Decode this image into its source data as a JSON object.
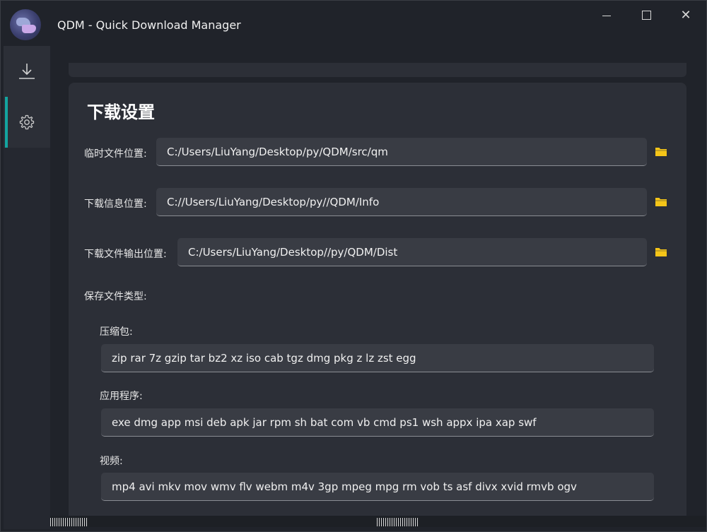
{
  "window": {
    "title": "QDM - Quick Download Manager",
    "min_symbol": "",
    "close_symbol": "✕"
  },
  "sidebar": {
    "items": [
      {
        "name": "download",
        "icon": "download-icon"
      },
      {
        "name": "settings",
        "icon": "gear-icon",
        "active": true
      }
    ]
  },
  "settings": {
    "title": "下载设置",
    "temp_location": {
      "label": "临时文件位置:",
      "value": "C:/Users/LiuYang/Desktop/py/QDM/src/qm"
    },
    "info_location": {
      "label": "下载信息位置:",
      "value": "C://Users/LiuYang/Desktop/py//QDM/Info"
    },
    "output_location": {
      "label": "下载文件输出位置:",
      "value": "C:/Users/LiuYang/Desktop//py/QDM/Dist"
    },
    "file_types_label": "保存文件类型:",
    "file_types": [
      {
        "label": "压缩包:",
        "value": "zip rar 7z gzip tar bz2 xz iso cab tgz dmg pkg z lz zst egg"
      },
      {
        "label": "应用程序:",
        "value": "exe dmg app msi deb apk jar rpm sh bat com vb cmd ps1 wsh appx ipa xap swf"
      },
      {
        "label": "视频:",
        "value": "mp4 avi mkv mov wmv flv webm m4v 3gp mpeg mpg rm vob ts asf divx xvid rmvb ogv"
      }
    ]
  },
  "colors": {
    "accent": "#14a5a0",
    "folder": "#f5c518",
    "background": "#20232a",
    "card": "#2c2f37",
    "input": "#393c44"
  }
}
